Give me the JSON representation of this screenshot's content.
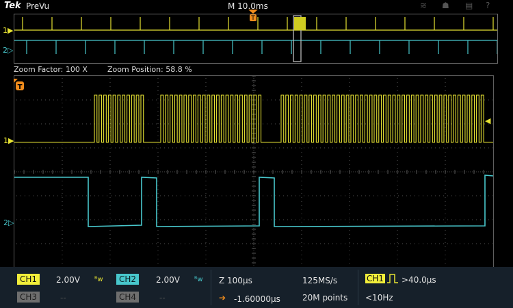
{
  "header": {
    "brand": "Tek",
    "mode": "PreVu",
    "horizontal_scale": "M 10.0ms"
  },
  "zoom": {
    "factor": "Zoom Factor: 100 X",
    "position": "Zoom Position: 58.8 %"
  },
  "markers": {
    "ch1": "1",
    "ch2": "2",
    "trigger": "T"
  },
  "channels": {
    "ch1": {
      "label": "CH1",
      "scale": "2.00V",
      "coupling": "ᴮw",
      "color": "#f2ee3a"
    },
    "ch2": {
      "label": "CH2",
      "scale": "2.00V",
      "coupling": "ᴮw",
      "color": "#48c7cc"
    },
    "ch3": {
      "label": "CH3",
      "scale": "--"
    },
    "ch4": {
      "label": "CH4",
      "scale": "--"
    }
  },
  "timebase": {
    "zoom_scale": "Z 100µs",
    "delay": "-1.60000µs",
    "sample_rate": "125MS/s",
    "record_length": "20M points"
  },
  "trigger": {
    "source": "CH1",
    "condition": ">40.0µs",
    "rate": "<10Hz"
  }
}
